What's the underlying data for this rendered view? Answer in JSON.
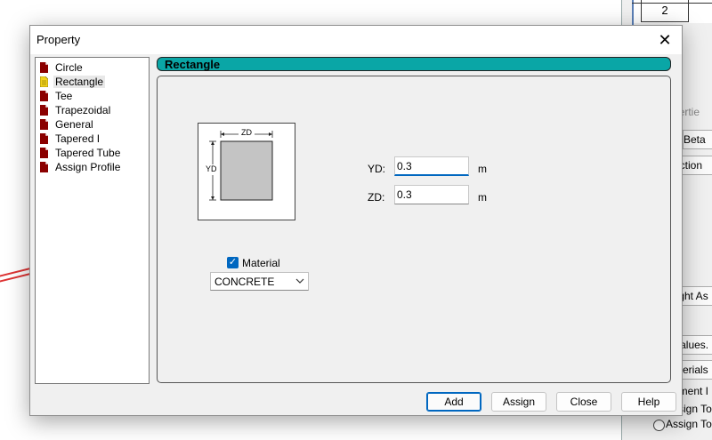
{
  "background": {
    "grid_row_value": "2",
    "fragments": [
      "pertie",
      "Beta",
      "ection",
      "light As",
      "Values.",
      "aterials",
      "nment I",
      "ssign To",
      "Assign To"
    ]
  },
  "dialog": {
    "title": "Property",
    "tree": {
      "items": [
        {
          "label": "Circle",
          "icon": "document-icon"
        },
        {
          "label": "Rectangle",
          "icon": "document-icon"
        },
        {
          "label": "Tee",
          "icon": "document-icon"
        },
        {
          "label": "Trapezoidal",
          "icon": "document-icon"
        },
        {
          "label": "General",
          "icon": "document-icon"
        },
        {
          "label": "Tapered I",
          "icon": "document-icon"
        },
        {
          "label": "Tapered Tube",
          "icon": "document-icon"
        },
        {
          "label": "Assign Profile",
          "icon": "document-icon"
        }
      ],
      "selected": "Rectangle"
    },
    "section": {
      "banner": "Rectangle",
      "diagram": {
        "zd_label": "ZD",
        "yd_label": "YD"
      },
      "yd": {
        "label": "YD:",
        "value": "0.3",
        "unit": "m"
      },
      "zd": {
        "label": "ZD:",
        "value": "0.3",
        "unit": "m"
      },
      "material": {
        "label": "Material",
        "checked": true,
        "selected": "CONCRETE"
      }
    },
    "buttons": {
      "add": "Add",
      "assign": "Assign",
      "close": "Close",
      "help": "Help"
    }
  },
  "colors": {
    "banner": "#0aa6a6",
    "accent": "#0067c0",
    "doc_icon": "#8b0000",
    "doc_selected": "#f2d21b"
  }
}
